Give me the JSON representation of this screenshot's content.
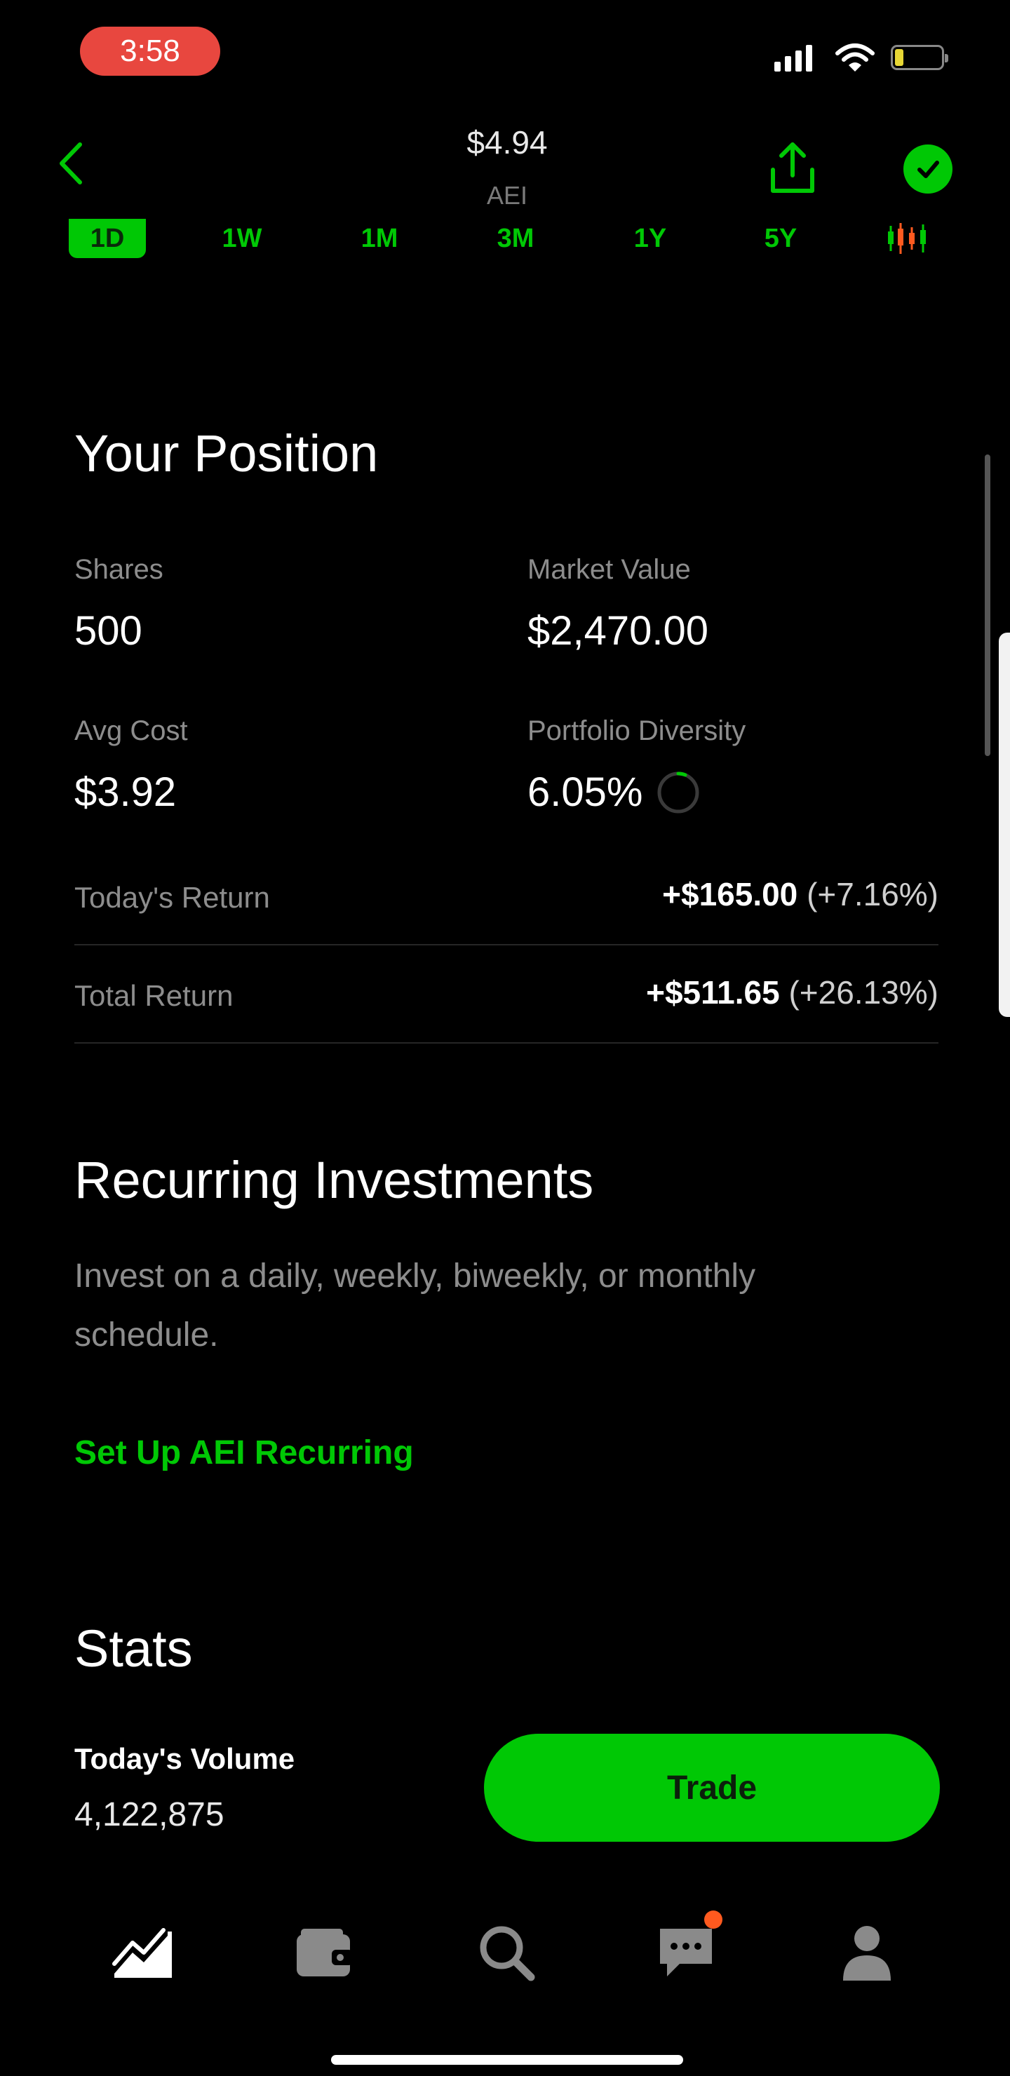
{
  "status_bar": {
    "time": "3:58"
  },
  "header": {
    "price": "$4.94",
    "ticker": "AEI"
  },
  "range_tabs": [
    "1D",
    "1W",
    "1M",
    "3M",
    "1Y",
    "5Y"
  ],
  "range_selected": "1D",
  "position": {
    "title": "Your Position",
    "shares_label": "Shares",
    "shares_value": "500",
    "market_value_label": "Market Value",
    "market_value": "$2,470.00",
    "avg_cost_label": "Avg Cost",
    "avg_cost": "$3.92",
    "diversity_label": "Portfolio Diversity",
    "diversity_value": "6.05%",
    "diversity_fraction": 0.0605,
    "today_return_label": "Today's Return",
    "today_return_amount": "+$165.00",
    "today_return_pct": "(+7.16%)",
    "total_return_label": "Total Return",
    "total_return_amount": "+$511.65",
    "total_return_pct": "(+26.13%)"
  },
  "recurring": {
    "title": "Recurring Investments",
    "description": "Invest on a daily, weekly, biweekly, or monthly schedule.",
    "link": "Set Up AEI Recurring"
  },
  "stats": {
    "title": "Stats",
    "volume_label": "Today's Volume",
    "volume_value": "4,122,875"
  },
  "trade_button": "Trade",
  "nav_icons": [
    "chart-icon",
    "wallet-icon",
    "search-icon",
    "chat-icon",
    "profile-icon"
  ],
  "colors": {
    "accent": "#00c805",
    "background": "#000000",
    "notification": "#ff5a1f",
    "status_pill": "#e8473f"
  }
}
